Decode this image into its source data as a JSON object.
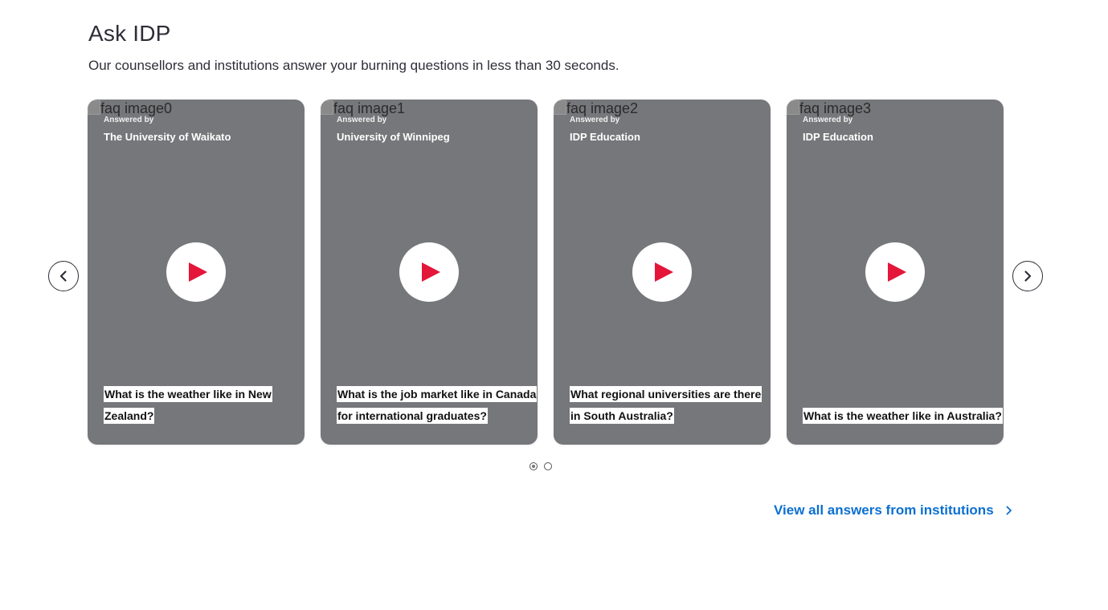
{
  "section": {
    "title": "Ask IDP",
    "subtitle": "Our counsellors and institutions answer your burning questions in less than 30 seconds."
  },
  "cards": [
    {
      "image_alt": "faq image0",
      "answered_by_label": "Answered by",
      "institution": "The University of Waikato",
      "question": "What is the weather like in New Zealand?"
    },
    {
      "image_alt": "faq image1",
      "answered_by_label": "Answered by",
      "institution": "University of Winnipeg",
      "question": "What is the job market like in Canada for international graduates?"
    },
    {
      "image_alt": "faq image2",
      "answered_by_label": "Answered by",
      "institution": "IDP Education",
      "question": "What regional universities are there in South Australia?"
    },
    {
      "image_alt": "faq image3",
      "answered_by_label": "Answered by",
      "institution": "IDP Education",
      "question": "What is the weather like in Australia?"
    }
  ],
  "carousel": {
    "prev_icon": "chevron-left-icon",
    "next_icon": "chevron-right-icon",
    "play_icon": "play-icon",
    "play_color": "#e4163a",
    "page_count": 2,
    "active_page": 1
  },
  "view_all": {
    "label": "View all answers from institutions",
    "icon": "chevron-right-icon",
    "color": "#0a6fd1"
  }
}
